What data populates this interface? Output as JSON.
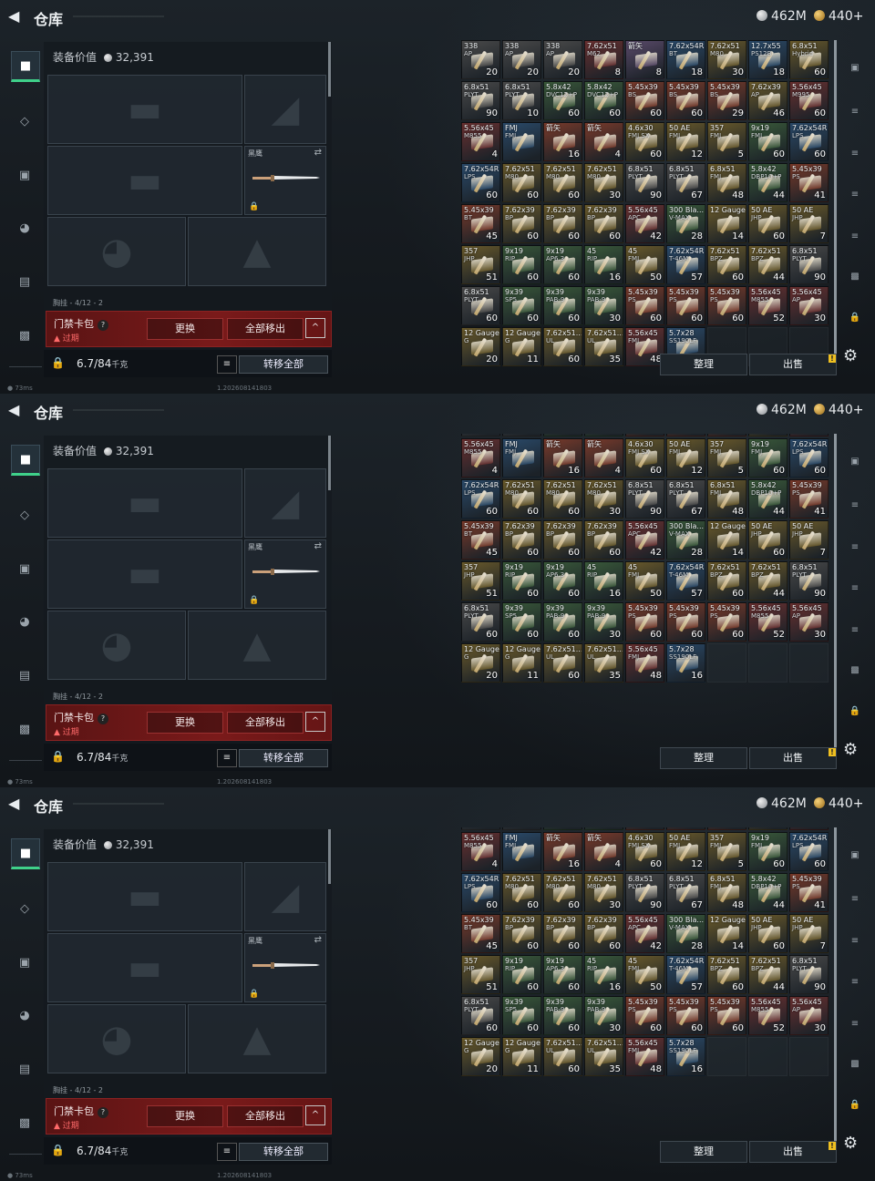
{
  "header": {
    "title": "仓库",
    "silver_amount": "462M",
    "gold_amount": "440+"
  },
  "loadout": {
    "value_label": "装备价值",
    "value": "32,391",
    "melee_slot_label": "黑鹰",
    "carrier_label": "胸挂 - 4/12 - 2",
    "keycard": {
      "name": "门禁卡包",
      "help": "?",
      "expired": "过期",
      "replace_button": "更换",
      "remove_all_button": "全部移出",
      "collapse": "^"
    },
    "capacity": {
      "value": "6.7/84",
      "unit": "千克",
      "transfer_all_button": "转移全部"
    }
  },
  "footer": {
    "ping": "73ms",
    "build": "1.202608141803"
  },
  "stash_buttons": {
    "sort": "整理",
    "sell": "出售",
    "warn": "!"
  },
  "colors": {
    "ammo_box_palette": {
      "a": "#7a3a2a",
      "b": "#2a4a6a",
      "c": "#3a5a3a",
      "d": "#5a4a6a",
      "e": "#6a5a2a",
      "f": "#2a5a5a",
      "g": "#4a4a4a",
      "h": "#6a3030"
    },
    "keycard_red": "#7a1a1a",
    "active_nav_green": "#3fd18a"
  },
  "nav_left": [
    {
      "icon": "gun-icon"
    },
    {
      "icon": "armor-icon"
    },
    {
      "icon": "backpack-icon"
    },
    {
      "icon": "helmet-icon"
    },
    {
      "icon": "case-icon"
    },
    {
      "icon": "briefcase-icon"
    }
  ],
  "nav_right": [
    {
      "icon": "safe-icon",
      "label": "🖫"
    },
    {
      "icon": "ammo-tab-icon",
      "label": "≡"
    },
    {
      "icon": "ammo-tab-icon",
      "label": "≡"
    },
    {
      "icon": "ammo-tab-icon",
      "label": "≡"
    },
    {
      "icon": "ammo-tab-icon",
      "label": "≡"
    },
    {
      "icon": "ammo-tab-icon",
      "label": "≡"
    },
    {
      "icon": "lock-icon",
      "label": "🔒"
    }
  ],
  "stash_rows": [
    [
      {
        "n": "338",
        "n2": "AP",
        "q": "20",
        "c": "g"
      },
      {
        "n": "338",
        "n2": "AP",
        "q": "20",
        "c": "g"
      },
      {
        "n": "338",
        "n2": "AP",
        "q": "20",
        "c": "g"
      },
      {
        "n": "7.62x51",
        "n2": "M62",
        "q": "8",
        "c": "h"
      },
      {
        "n": "箭矢",
        "n2": "",
        "q": "8",
        "c": "d"
      },
      {
        "n": "7.62x54R",
        "n2": "BT",
        "q": "18",
        "c": "b"
      },
      {
        "n": "7.62x51",
        "n2": "M80",
        "q": "30",
        "c": "e"
      },
      {
        "n": "12.7x55",
        "n2": "PS12B",
        "q": "18",
        "c": "b"
      },
      {
        "n": "6.8x51",
        "n2": "Hybrid",
        "q": "60",
        "c": "e"
      }
    ],
    [
      {
        "n": "6.8x51",
        "n2": "PLYT",
        "q": "90",
        "c": "g"
      },
      {
        "n": "6.8x51",
        "n2": "PLYT",
        "q": "10",
        "c": "g"
      },
      {
        "n": "5.8x42",
        "n2": "DVC12+P",
        "q": "60",
        "c": "c"
      },
      {
        "n": "5.8x42",
        "n2": "DVC12+P",
        "q": "60",
        "c": "c"
      },
      {
        "n": "5.45x39",
        "n2": "BS",
        "q": "60",
        "c": "a"
      },
      {
        "n": "5.45x39",
        "n2": "BS",
        "q": "60",
        "c": "a"
      },
      {
        "n": "5.45x39",
        "n2": "BS",
        "q": "29",
        "c": "a"
      },
      {
        "n": "7.62x39",
        "n2": "AP",
        "q": "46",
        "c": "e"
      },
      {
        "n": "5.56x45",
        "n2": "M995",
        "q": "60",
        "c": "h"
      }
    ],
    [
      {
        "n": "5.56x45",
        "n2": "M855",
        "q": "4",
        "c": "h"
      },
      {
        "n": "FMJ",
        "n2": "FMJ",
        "q": "",
        "c": "b"
      },
      {
        "n": "箭矢",
        "n2": "",
        "q": "16",
        "c": "a"
      },
      {
        "n": "箭矢",
        "n2": "",
        "q": "4",
        "c": "a"
      },
      {
        "n": "4.6x30",
        "n2": "FMJ SX",
        "q": "60",
        "c": "e"
      },
      {
        "n": "50 AE",
        "n2": "FMJ",
        "q": "12",
        "c": "e"
      },
      {
        "n": "357",
        "n2": "FMJ",
        "q": "5",
        "c": "e"
      },
      {
        "n": "9x19",
        "n2": "FMJ",
        "q": "60",
        "c": "c"
      },
      {
        "n": "7.62x54R",
        "n2": "LPS",
        "q": "60",
        "c": "b"
      }
    ],
    [
      {
        "n": "7.62x54R",
        "n2": "LPS",
        "q": "60",
        "c": "b"
      },
      {
        "n": "7.62x51",
        "n2": "M80",
        "q": "60",
        "c": "e"
      },
      {
        "n": "7.62x51",
        "n2": "M80",
        "q": "60",
        "c": "e"
      },
      {
        "n": "7.62x51",
        "n2": "M80",
        "q": "30",
        "c": "e"
      },
      {
        "n": "6.8x51",
        "n2": "PLYT",
        "q": "90",
        "c": "g"
      },
      {
        "n": "6.8x51",
        "n2": "PLYT",
        "q": "67",
        "c": "g"
      },
      {
        "n": "6.8x51",
        "n2": "FMJ",
        "q": "48",
        "c": "e"
      },
      {
        "n": "5.8x42",
        "n2": "DBP10+P",
        "q": "44",
        "c": "c"
      },
      {
        "n": "5.45x39",
        "n2": "PS",
        "q": "41",
        "c": "a"
      }
    ],
    [
      {
        "n": "5.45x39",
        "n2": "BT",
        "q": "45",
        "c": "a"
      },
      {
        "n": "7.62x39",
        "n2": "BP",
        "q": "60",
        "c": "e"
      },
      {
        "n": "7.62x39",
        "n2": "BP",
        "q": "60",
        "c": "e"
      },
      {
        "n": "7.62x39",
        "n2": "BP",
        "q": "60",
        "c": "e"
      },
      {
        "n": "5.56x45",
        "n2": "APC",
        "q": "42",
        "c": "h"
      },
      {
        "n": "300 Bla...",
        "n2": "V-MAX",
        "q": "28",
        "c": "c"
      },
      {
        "n": "12 Gauge",
        "n2": "",
        "q": "14",
        "c": "e"
      },
      {
        "n": "50 AE",
        "n2": "JHP",
        "q": "60",
        "c": "e"
      },
      {
        "n": "50 AE",
        "n2": "JHP",
        "q": "7",
        "c": "e"
      }
    ],
    [
      {
        "n": "357",
        "n2": "JHP",
        "q": "51",
        "c": "e"
      },
      {
        "n": "9x19",
        "n2": "RIP",
        "q": "60",
        "c": "c"
      },
      {
        "n": "9x19",
        "n2": "AP6.3",
        "q": "60",
        "c": "c"
      },
      {
        "n": "45",
        "n2": "RIP",
        "q": "16",
        "c": "c"
      },
      {
        "n": "45",
        "n2": "FMJ",
        "q": "50",
        "c": "e"
      },
      {
        "n": "7.62x54R",
        "n2": "T-46M",
        "q": "57",
        "c": "b"
      },
      {
        "n": "7.62x51",
        "n2": "BPZ",
        "q": "60",
        "c": "e"
      },
      {
        "n": "7.62x51",
        "n2": "BPZ",
        "q": "44",
        "c": "e"
      },
      {
        "n": "6.8x51",
        "n2": "PLYT",
        "q": "90",
        "c": "g"
      }
    ],
    [
      {
        "n": "6.8x51",
        "n2": "PLYT",
        "q": "60",
        "c": "g"
      },
      {
        "n": "9x39",
        "n2": "SP5",
        "q": "60",
        "c": "c"
      },
      {
        "n": "9x39",
        "n2": "PAB-9",
        "q": "60",
        "c": "c"
      },
      {
        "n": "9x39",
        "n2": "PAB-9",
        "q": "30",
        "c": "c"
      },
      {
        "n": "5.45x39",
        "n2": "PS",
        "q": "60",
        "c": "a"
      },
      {
        "n": "5.45x39",
        "n2": "PS",
        "q": "60",
        "c": "a"
      },
      {
        "n": "5.45x39",
        "n2": "PS",
        "q": "60",
        "c": "a"
      },
      {
        "n": "5.56x45",
        "n2": "M855",
        "q": "52",
        "c": "h"
      },
      {
        "n": "5.56x45",
        "n2": "AP",
        "q": "30",
        "c": "h"
      }
    ],
    [
      {
        "n": "12 Gauge",
        "n2": "G",
        "q": "20",
        "c": "e"
      },
      {
        "n": "12 Gauge",
        "n2": "G",
        "q": "11",
        "c": "e"
      },
      {
        "n": "7.62x51...",
        "n2": "UL",
        "q": "60",
        "c": "e"
      },
      {
        "n": "7.62x51...",
        "n2": "UL",
        "q": "35",
        "c": "e"
      },
      {
        "n": "5.56x45",
        "n2": "FMJ",
        "q": "48",
        "c": "h"
      },
      {
        "n": "5.7x28",
        "n2": "SS190LF",
        "q": "16",
        "c": "b"
      }
    ]
  ]
}
